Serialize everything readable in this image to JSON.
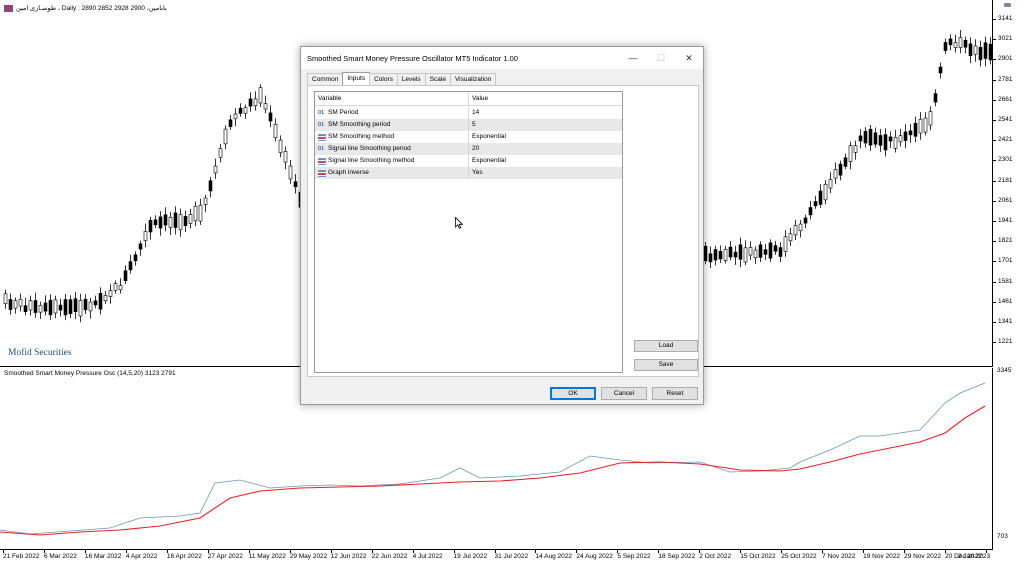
{
  "header": {
    "symbol_line": "طوسـازی امین ، Daily : 2890 2852 2928 2900 ،بابامین",
    "watermark": "Mofid Securities",
    "oscillator_label": "Smoothed Smart Money Pressure Osc (14,5,20) 3123 2791"
  },
  "price_axis": [
    "3141",
    "3021",
    "2901",
    "2781",
    "2661",
    "2541",
    "2421",
    "2301",
    "2181",
    "2061",
    "1941",
    "1821",
    "1701",
    "1581",
    "1461",
    "1341",
    "1221"
  ],
  "osc_axis": {
    "top": "3345",
    "bottom": "703"
  },
  "time_axis": [
    "21 Feb 2022",
    "6 Mar 2022",
    "16 Mar 2022",
    "4 Apr 2022",
    "16 Apr 2022",
    "27 Apr 2022",
    "11 May 2022",
    "29 May 2022",
    "12 Jun 2022",
    "22 Jun 2022",
    "4 Jul 2022",
    "19 Jul 2022",
    "31 Jul 2022",
    "14 Aug 2022",
    "24 Aug 2022",
    "5 Sep 2022",
    "18 Sep 2022",
    "2 Oct 2022",
    "15 Oct 2022",
    "25 Oct 2022",
    "7 Nov 2022",
    "19 Nov 2022",
    "29 Nov 2022",
    "20 Dec 2022",
    "2 Jan 2023"
  ],
  "dialog": {
    "title": "Smoothed Smart Money Pressure Oscillator MT5 Indicator 1.00",
    "window_buttons": {
      "minimize": "—",
      "maximize": "☐",
      "close": "✕"
    },
    "tabs": [
      "Common",
      "Inputs",
      "Colors",
      "Levels",
      "Scale",
      "Visualization"
    ],
    "active_tab": "Inputs",
    "grid": {
      "headers": {
        "variable": "Variable",
        "value": "Value"
      },
      "rows": [
        {
          "type": "01",
          "variable": "SM Period",
          "value": "14"
        },
        {
          "type": "01",
          "variable": "SM Smoothing period",
          "value": "5"
        },
        {
          "type": "enum",
          "variable": "SM Smoothing method",
          "value": "Exponential"
        },
        {
          "type": "01",
          "variable": "Signal line Smoothing period",
          "value": "20"
        },
        {
          "type": "enum",
          "variable": "Signal line Smoothing method",
          "value": "Exponential"
        },
        {
          "type": "enum",
          "variable": "Graph inverse",
          "value": "Yes"
        }
      ]
    },
    "buttons": {
      "load": "Load",
      "save": "Save",
      "ok": "OK",
      "cancel": "Cancel",
      "reset": "Reset"
    }
  },
  "colors": {
    "accent": "#0078d7",
    "signal_line": "#e8202a",
    "main_line": "#6b96b8",
    "watermark": "#1f4e79"
  }
}
